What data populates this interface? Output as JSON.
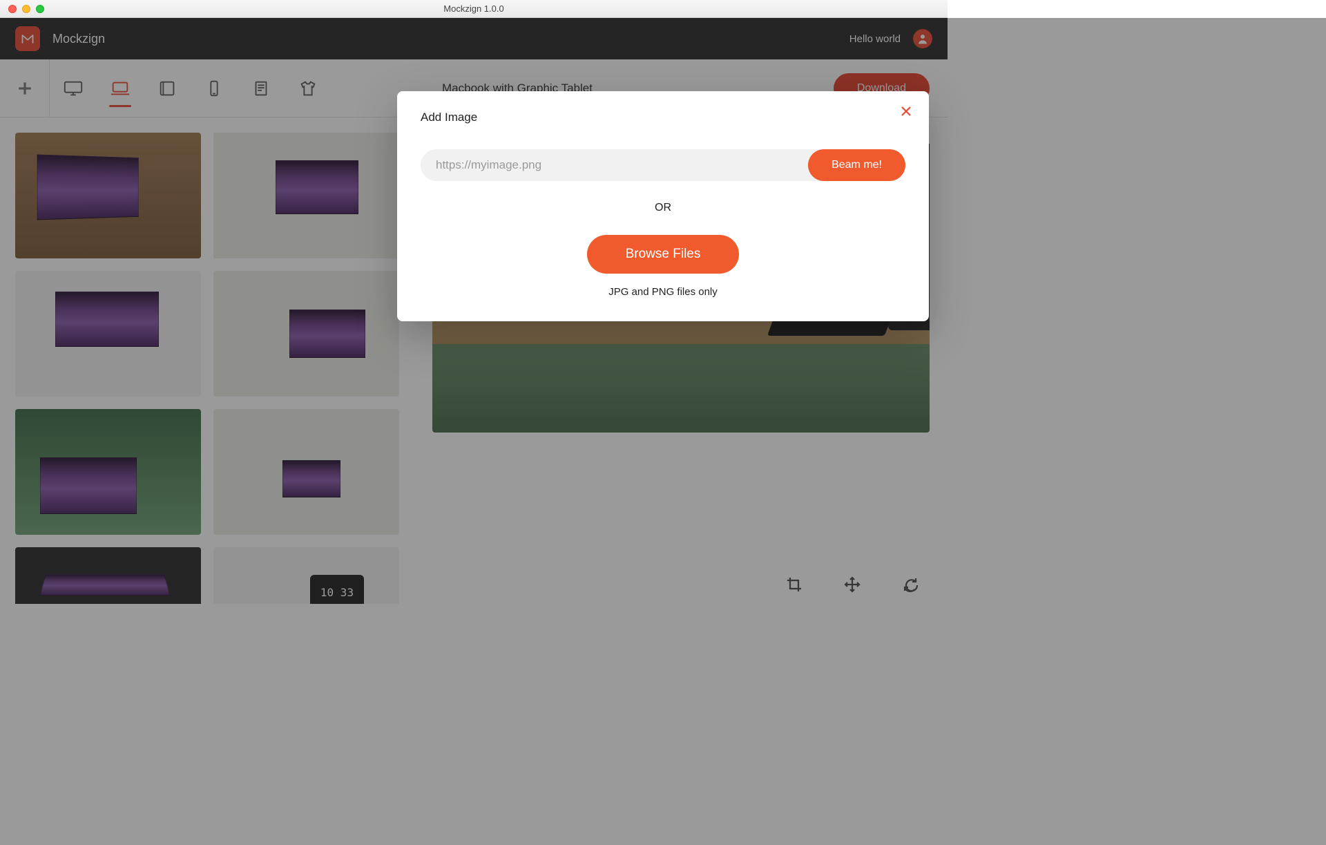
{
  "window": {
    "title": "Mockzign 1.0.0"
  },
  "header": {
    "brand": "Mockzign",
    "greeting": "Hello world"
  },
  "toolbar": {
    "items": [
      {
        "name": "add",
        "active": false
      },
      {
        "name": "desktop",
        "active": false
      },
      {
        "name": "laptop",
        "active": true
      },
      {
        "name": "tablet",
        "active": false
      },
      {
        "name": "phone",
        "active": false
      },
      {
        "name": "paper",
        "active": false
      },
      {
        "name": "apparel",
        "active": false
      }
    ],
    "mockup_title": "Macbook with Graphic Tablet",
    "download_label": "Download"
  },
  "thumbs": {
    "selected_index": 1
  },
  "modal": {
    "title": "Add Image",
    "url_placeholder": "https://myimage.png",
    "beam_label": "Beam me!",
    "or_label": "OR",
    "browse_label": "Browse Files",
    "note": "JPG and PNG files only"
  },
  "preview_controls": [
    "crop",
    "move",
    "rotate"
  ]
}
